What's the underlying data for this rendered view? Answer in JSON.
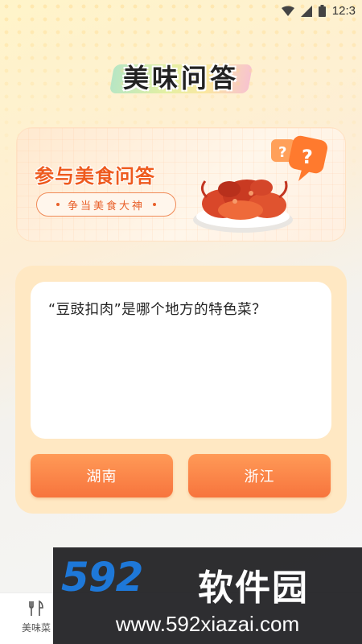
{
  "status_bar": {
    "time": "12:3"
  },
  "page_title": "美味问答",
  "banner": {
    "headline": "参与美食问答",
    "pill_text": "争当美食大神"
  },
  "quiz": {
    "question": "“豆豉扣肉”是哪个地方的特色菜？",
    "options": [
      "湖南",
      "浙江"
    ]
  },
  "tab_bar": {
    "items": [
      {
        "label": "美味菜",
        "icon": "fork-knife-icon"
      }
    ]
  },
  "watermark": {
    "logo": "592",
    "name": "软件园",
    "url": "www.592xiazai.com"
  },
  "colors": {
    "accent": "#f7743d",
    "banner_text": "#ee5a1e",
    "card_bg": "#ffe8c3"
  }
}
